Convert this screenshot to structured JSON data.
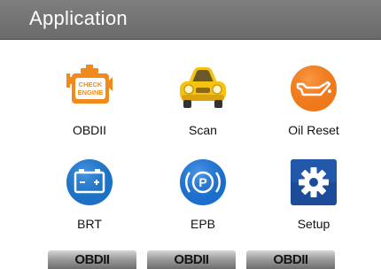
{
  "header": {
    "title": "Application"
  },
  "apps": [
    {
      "label": "OBDII",
      "icon": "check-engine-icon"
    },
    {
      "label": "Scan",
      "icon": "car-icon"
    },
    {
      "label": "Oil Reset",
      "icon": "oil-can-icon"
    },
    {
      "label": "BRT",
      "icon": "battery-icon"
    },
    {
      "label": "EPB",
      "icon": "parking-brake-icon"
    },
    {
      "label": "Setup",
      "icon": "gear-icon"
    }
  ],
  "footer": {
    "buttons": [
      "OBDII",
      "OBDII",
      "OBDII"
    ]
  },
  "colors": {
    "title_bar": "#727272",
    "engine_orange": "#f08a1c",
    "car_yellow": "#f5c20f",
    "oil_orange": "#f07a1a",
    "battery_blue": "#1a73c8",
    "epb_blue": "#1a6fd0",
    "setup_blue": "#1b4c9a"
  }
}
